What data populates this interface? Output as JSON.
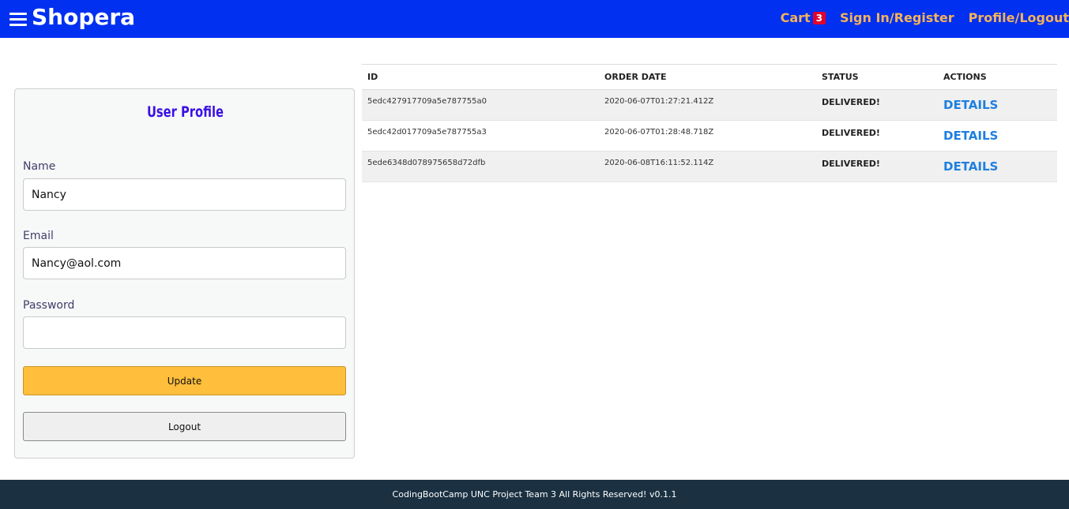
{
  "header": {
    "brand": "Shopera",
    "cart_label": "Cart",
    "cart_count": "3",
    "signin_label": "Sign In/Register",
    "profile_label": "Profile/Logout"
  },
  "profile": {
    "title": "User Profile",
    "name_label": "Name",
    "name_value": "Nancy",
    "email_label": "Email",
    "email_value": "Nancy@aol.com",
    "password_label": "Password",
    "password_value": "",
    "update_label": "Update",
    "logout_label": "Logout"
  },
  "orders": {
    "columns": [
      "ID",
      "ORDER DATE",
      "STATUS",
      "ACTIONS"
    ],
    "rows": [
      {
        "id": "5edc427917709a5e787755a0",
        "date": "2020-06-07T01:27:21.412Z",
        "status": "DELIVERED!",
        "action": "DETAILS"
      },
      {
        "id": "5edc42d017709a5e787755a3",
        "date": "2020-06-07T01:28:48.718Z",
        "status": "DELIVERED!",
        "action": "DETAILS"
      },
      {
        "id": "5ede6348d078975658d72dfb",
        "date": "2020-06-08T16:11:52.114Z",
        "status": "DELIVERED!",
        "action": "DETAILS"
      }
    ]
  },
  "footer": {
    "text": "CodingBootCamp UNC Project Team 3 All Rights Reserved! v0.1.1"
  },
  "colors": {
    "header_bg": "#0130f0",
    "nav_link": "#f5b25a",
    "badge": "#e4002b",
    "update_button": "#ffbe3c",
    "details_link": "#1e7fe0",
    "footer_bg": "#1b3142"
  }
}
